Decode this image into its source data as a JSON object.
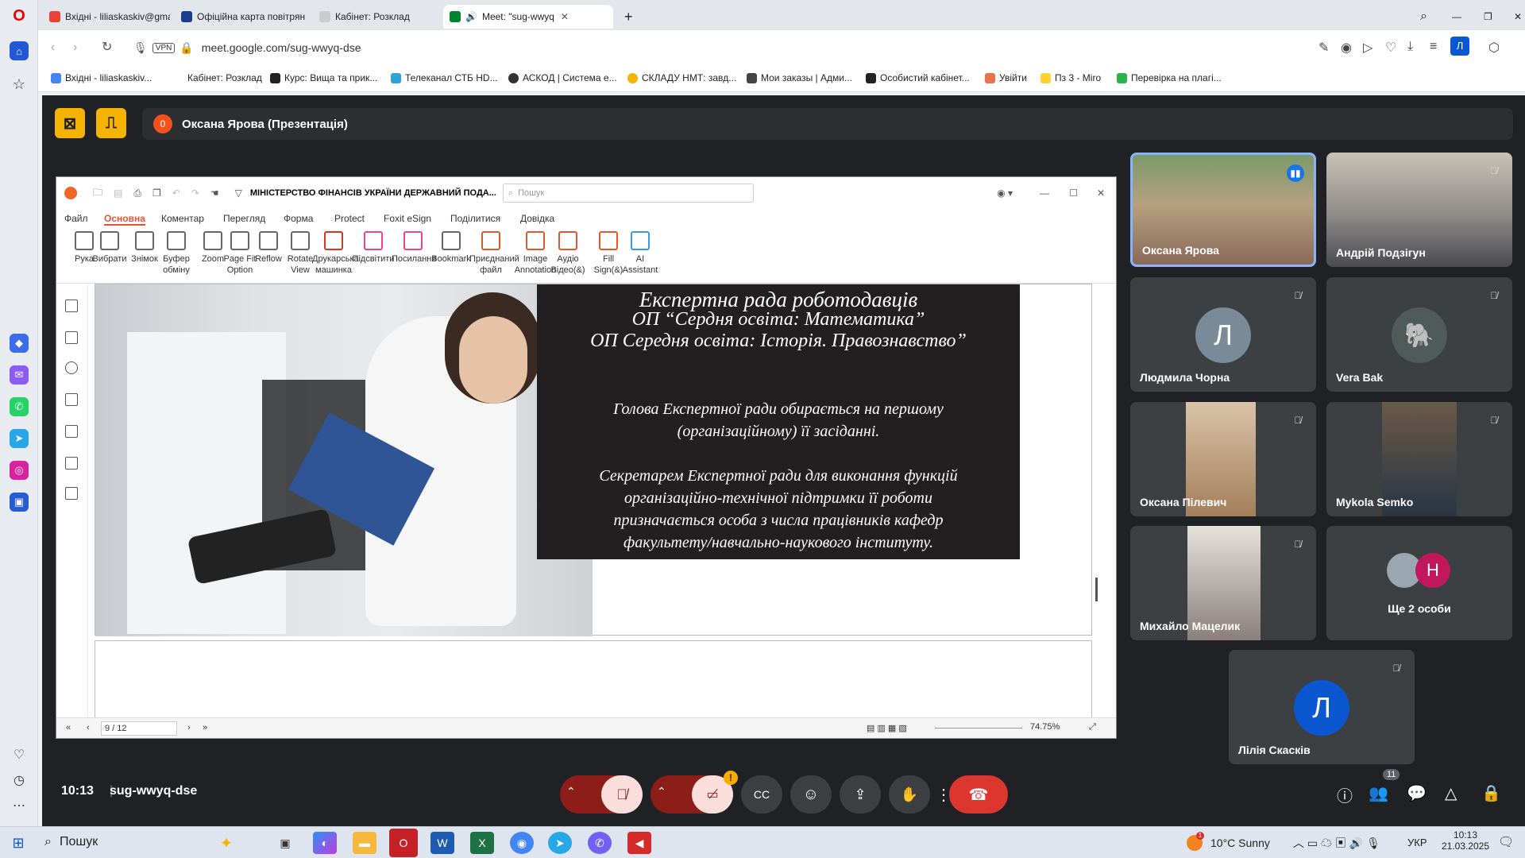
{
  "browser": {
    "tabs": [
      {
        "label": "Вхідні - liliaskaskiv@gmai",
        "active": false
      },
      {
        "label": "Офіційна карта повітрян",
        "active": false
      },
      {
        "label": "Кабінет: Розклад",
        "active": false
      },
      {
        "label": "Meet: \"sug-wwyq",
        "active": true
      }
    ],
    "url": "meet.google.com/sug-wwyq-dse",
    "vpn": "VPN",
    "bookmarks": [
      "Вхідні - liliaskaskiv...",
      "Кабінет: Розклад",
      "Курс: Вища та прик...",
      "Телеканал СТБ HD...",
      "АСКОД | Система е...",
      "СКЛАДУ НМТ: завд...",
      "Мои заказы | Адми...",
      "Особистий кабінет...",
      "Увійти",
      "Пз 3 - Miro",
      "Перевірка на плагі..."
    ],
    "profile_letter": "Л"
  },
  "meet": {
    "presenter_badge": "0",
    "presenter_label": "Оксана Ярова (Презентація)",
    "time": "10:13",
    "meeting_code": "sug-wwyq-dse",
    "people_count": "11",
    "participants": [
      {
        "name": "Оксана Ярова",
        "type": "video",
        "speaking": true
      },
      {
        "name": "Андрій Подзігун",
        "type": "video"
      },
      {
        "name": "Людмила Чорна",
        "type": "avatar",
        "letter": "Л",
        "color": "#7b8a99"
      },
      {
        "name": "Vera Bak",
        "type": "avatar",
        "letter": "",
        "color": "#6b7b78"
      },
      {
        "name": "Оксана Пілевич",
        "type": "video"
      },
      {
        "name": "Mykola Semko",
        "type": "video"
      },
      {
        "name": "Михайло Мацелик",
        "type": "video"
      },
      {
        "name": "Ще 2 особи",
        "type": "group",
        "letter": "Н"
      },
      {
        "name": "Лілія Скаскiв",
        "type": "avatar",
        "letter": "Л",
        "color": "#0b57d0"
      }
    ]
  },
  "foxit": {
    "doc_title": "МІНІСТЕРСТВО ФІНАНСІВ УКРАЇНИ ДЕРЖАВНИЙ ПОДА...",
    "search_placeholder": "Пошук",
    "menu": [
      "Файл",
      "Основна",
      "Коментар",
      "Перегляд",
      "Форма",
      "Protect",
      "Foxit eSign",
      "Поділитися",
      "Довідка"
    ],
    "ribbon": [
      {
        "l1": "Рука",
        "l2": ""
      },
      {
        "l1": "Вибрати",
        "l2": ""
      },
      {
        "l1": "Знімок",
        "l2": ""
      },
      {
        "l1": "Буфер",
        "l2": "обміну"
      },
      {
        "l1": "Zoom",
        "l2": ""
      },
      {
        "l1": "Page Fit",
        "l2": "Option"
      },
      {
        "l1": "Reflow",
        "l2": ""
      },
      {
        "l1": "Rotate",
        "l2": "View"
      },
      {
        "l1": "Друкарська",
        "l2": "машинка"
      },
      {
        "l1": "Підсвітити",
        "l2": ""
      },
      {
        "l1": "Посилання",
        "l2": ""
      },
      {
        "l1": "Bookmark",
        "l2": ""
      },
      {
        "l1": "Приєднаний",
        "l2": "файл"
      },
      {
        "l1": "Image",
        "l2": "Annotation"
      },
      {
        "l1": "Аудіо",
        "l2": "Відео(&)"
      },
      {
        "l1": "Fill",
        "l2": "Sign(&)"
      },
      {
        "l1": "AI",
        "l2": "Assistant"
      }
    ],
    "page": "9 / 12",
    "zoom": "74.75%",
    "slide": {
      "title1": "Експертна рада роботодавців",
      "title2": "ОП “Сердня освіта: Математика”",
      "title3": "ОП Середня освіта: Історія. Правознавство”",
      "p1a": "Голова Експертної ради обирається на першому",
      "p1b": "(організаційному) її  засіданні.",
      "p2a": "Секретарем Експертної ради для виконання функцій",
      "p2b": "організаційно-технічної підтримки її роботи",
      "p2c": "призначається особа з числа працівників кафедр",
      "p2d": "факультету/навчально-наукового інституту."
    }
  },
  "taskbar": {
    "search": "Пошук",
    "weather": "10°C  Sunny",
    "lang": "УКР",
    "clock_time": "10:13",
    "clock_date": "21.03.2025",
    "notif": "1"
  }
}
